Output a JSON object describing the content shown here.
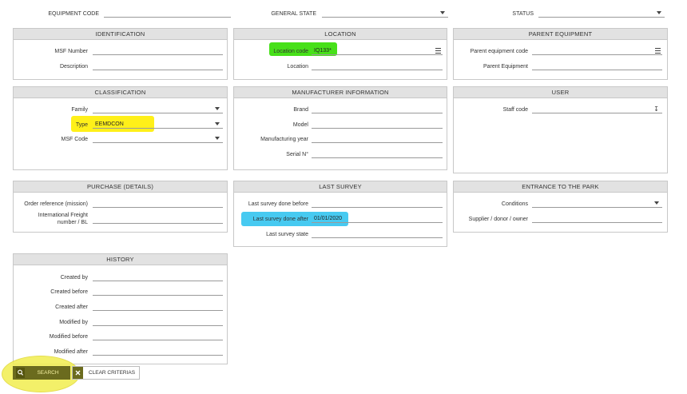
{
  "filters": {
    "equipment_code_label": "EQUIPMENT CODE",
    "equipment_code_value": "",
    "general_state_label": "GENERAL STATE",
    "general_state_value": "",
    "status_label": "STATUS",
    "status_value": ""
  },
  "identification": {
    "title": "IDENTIFICATION",
    "msf_number_label": "MSF Number",
    "description_label": "Description"
  },
  "location": {
    "title": "LOCATION",
    "location_code_label": "Location code",
    "location_code_value": "IQ133*",
    "location_label": "Location"
  },
  "parent": {
    "title": "PARENT EQUIPMENT",
    "code_label": "Parent equipment code",
    "name_label": "Parent Equipment"
  },
  "classification": {
    "title": "CLASSIFICATION",
    "family_label": "Family",
    "type_label": "Type",
    "type_value": "EEMDCON",
    "msf_code_label": "MSF Code"
  },
  "manufacturer": {
    "title": "MANUFACTURER INFORMATION",
    "brand_label": "Brand",
    "model_label": "Model",
    "year_label": "Manufacturing year",
    "serial_label": "Serial N°"
  },
  "user": {
    "title": "USER",
    "staff_code_label": "Staff code"
  },
  "purchase": {
    "title": "PURCHASE (DETAILS)",
    "order_label": "Order reference (mission)",
    "freight_label_1": "International Freight",
    "freight_label_2": "number / BL"
  },
  "survey": {
    "title": "LAST SURVEY",
    "before_label": "Last survey done before",
    "after_label": "Last survey done after",
    "after_value": "01/01/2020",
    "state_label": "Last survey state"
  },
  "entrance": {
    "title": "ENTRANCE TO THE PARK",
    "conditions_label": "Conditions",
    "supplier_label": "Supplier / donor / owner"
  },
  "history": {
    "title": "HISTORY",
    "created_by_label": "Created by",
    "created_before_label": "Created before",
    "created_after_label": "Created after",
    "modified_by_label": "Modified by",
    "modified_before_label": "Modified before",
    "modified_after_label": "Modified after"
  },
  "actions": {
    "search_label": "SEARCH",
    "clear_label": "CLEAR CRITERIAS"
  },
  "colors": {
    "highlight_green": "#33dd00",
    "highlight_yellow": "#ffee00",
    "highlight_blue": "#33c4f0",
    "button_olive": "#6b6b1e",
    "circle_yellow": "#f2ee50"
  },
  "icons": [
    "search-icon",
    "close-icon",
    "chevron-down-icon",
    "list-icon",
    "arrow-down-icon"
  ]
}
